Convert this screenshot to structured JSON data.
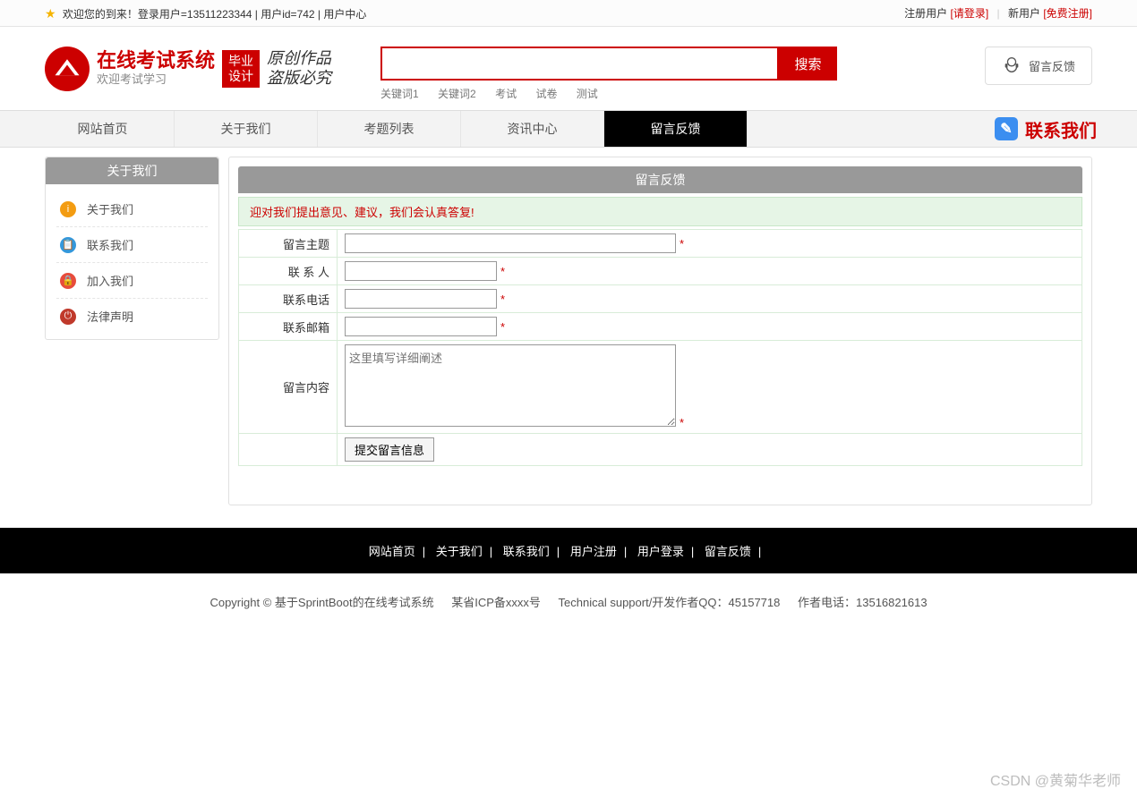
{
  "topbar": {
    "welcome": "欢迎您的到来！登录用户=13511223344 | 用户id=742 | 用户中心",
    "reg_user": "注册用户",
    "login_link": "[请登录]",
    "new_user": "新用户",
    "free_reg": "[免费注册]"
  },
  "header": {
    "title": "在线考试系统",
    "subtitle": "欢迎考试学习",
    "badge1": "毕业",
    "badge2": "设计",
    "calli1": "原创作品",
    "calli2": "盗版必究",
    "search_btn": "搜索",
    "keywords": [
      "关键词1",
      "关键词2",
      "考试",
      "试卷",
      "测试"
    ],
    "feedback": "留言反馈"
  },
  "nav": {
    "items": [
      "网站首页",
      "关于我们",
      "考题列表",
      "资讯中心",
      "留言反馈"
    ],
    "contact": "联系我们"
  },
  "sidebar": {
    "title": "关于我们",
    "items": [
      {
        "label": "关于我们"
      },
      {
        "label": "联系我们"
      },
      {
        "label": "加入我们"
      },
      {
        "label": "法律声明"
      }
    ]
  },
  "panel": {
    "title": "留言反馈",
    "tip": "迎对我们提出意见、建议，我们会认真答复!",
    "f1": "留言主题",
    "f2": "联 系 人",
    "f3": "联系电话",
    "f4": "联系邮箱",
    "f5": "留言内容",
    "ta_placeholder": "这里填写详细阐述",
    "submit": "提交留言信息",
    "star": "*"
  },
  "footer": {
    "links": [
      "网站首页",
      "关于我们",
      "联系我们",
      "用户注册",
      "用户登录",
      "留言反馈"
    ],
    "copy": "Copyright © 基于SprintBoot的在线考试系统",
    "icp": "某省ICP备xxxx号",
    "tech": "Technical support/开发作者QQ：45157718",
    "phone": "作者电话：13516821613"
  },
  "watermark": "CSDN @黄菊华老师"
}
